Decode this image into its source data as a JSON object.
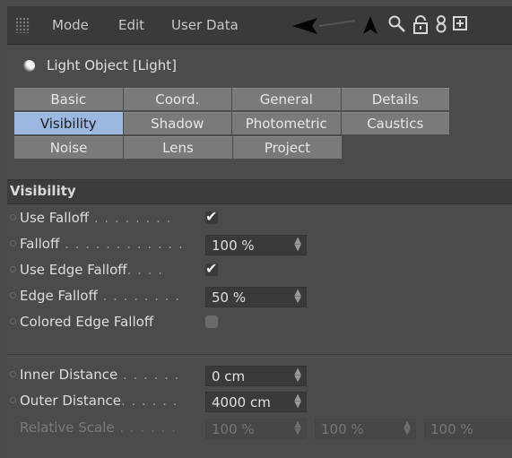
{
  "menubar": {
    "items": [
      "Mode",
      "Edit",
      "User Data"
    ]
  },
  "object": {
    "title": "Light Object [Light]",
    "icon": "light-bulb-icon"
  },
  "tabs": [
    [
      {
        "label": "Basic",
        "active": false
      },
      {
        "label": "Coord.",
        "active": false
      },
      {
        "label": "General",
        "active": false
      },
      {
        "label": "Details",
        "active": false
      }
    ],
    [
      {
        "label": "Visibility",
        "active": true
      },
      {
        "label": "Shadow",
        "active": false
      },
      {
        "label": "Photometric",
        "active": false
      },
      {
        "label": "Caustics",
        "active": false
      }
    ],
    [
      {
        "label": "Noise",
        "active": false
      },
      {
        "label": "Lens",
        "active": false
      },
      {
        "label": "Project",
        "active": false
      }
    ]
  ],
  "section": {
    "title": "Visibility"
  },
  "params": {
    "use_falloff": {
      "label": "Use Falloff",
      "dots": " . . . . . . . .",
      "checked": true
    },
    "falloff": {
      "label": "Falloff",
      "dots": " . . . . . . . . . . . .",
      "value": "100 %"
    },
    "use_edge_falloff": {
      "label": "Use Edge Falloff",
      "dots": ". . . .",
      "checked": true
    },
    "edge_falloff": {
      "label": "Edge Falloff",
      "dots": " . . . . . . . .",
      "value": "50 %"
    },
    "colored_edge_falloff": {
      "label": "Colored Edge Falloff",
      "checked": false
    },
    "inner_distance": {
      "label": "Inner Distance",
      "dots": " . . . . . .",
      "value": "0 cm"
    },
    "outer_distance": {
      "label": "Outer Distance",
      "dots": ". . . . . .",
      "value": "4000 cm"
    },
    "relative_scale": {
      "label": "Relative Scale",
      "dots": " . . . . . .",
      "values": [
        "100 %",
        "100 %",
        "100 %"
      ]
    }
  },
  "colors": {
    "active_tab": "#9cb7e0",
    "panel_bg": "#4b4b4b",
    "menubar_bg": "#3a3a3a"
  }
}
